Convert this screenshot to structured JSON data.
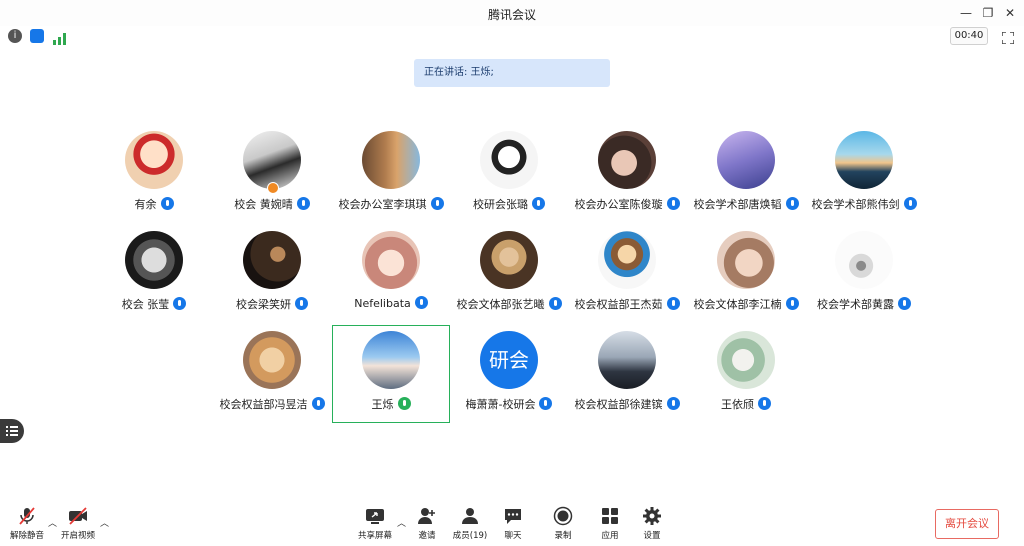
{
  "window": {
    "title": "腾讯会议"
  },
  "status": {
    "timer": "00:40"
  },
  "speaking": {
    "text": "正在讲话: 王烁;"
  },
  "participants": [
    {
      "name": "有余",
      "avatar": "cartoon-child"
    },
    {
      "name": "校会 黄婉晴",
      "avatar": "girl-photo",
      "host": true
    },
    {
      "name": "校会办公室李琪琪",
      "avatar": "building"
    },
    {
      "name": "校研会张璐",
      "avatar": "cartoon-girl"
    },
    {
      "name": "校会办公室陈俊璇",
      "avatar": "girl-face"
    },
    {
      "name": "校会学术部唐焕韬",
      "avatar": "purple-sky"
    },
    {
      "name": "校会学术部熊伟剑",
      "avatar": "sunset-sea"
    },
    {
      "name": "校会 张莹",
      "avatar": "baby-bw"
    },
    {
      "name": "校会梁笑妍",
      "avatar": "dark-scene"
    },
    {
      "name": "Nefelibata",
      "avatar": "anime-girl"
    },
    {
      "name": "校会文体部张艺曦",
      "avatar": "blonde-girl"
    },
    {
      "name": "校会权益部王杰茹",
      "avatar": "anime-yellow"
    },
    {
      "name": "校会文体部李江楠",
      "avatar": "face-closeup"
    },
    {
      "name": "校会学术部黄露",
      "avatar": "sketch"
    },
    {
      "name": "校会权益部冯昱洁",
      "avatar": "cat"
    },
    {
      "name": "王烁",
      "avatar": "hand-sky",
      "active": true
    },
    {
      "name": "梅萧萧-校研会",
      "avatar_text": "研会"
    },
    {
      "name": "校会权益部徐建镔",
      "avatar": "dusk-scene"
    },
    {
      "name": "王依颀",
      "avatar": "green-art"
    }
  ],
  "toolbar": {
    "unmute": "解除静音",
    "start_video": "开启视频",
    "share_screen": "共享屏幕",
    "invite": "邀请",
    "members": "成员(19)",
    "chat": "聊天",
    "record": "录制",
    "apps": "应用",
    "settings": "设置",
    "leave": "离开会议"
  }
}
